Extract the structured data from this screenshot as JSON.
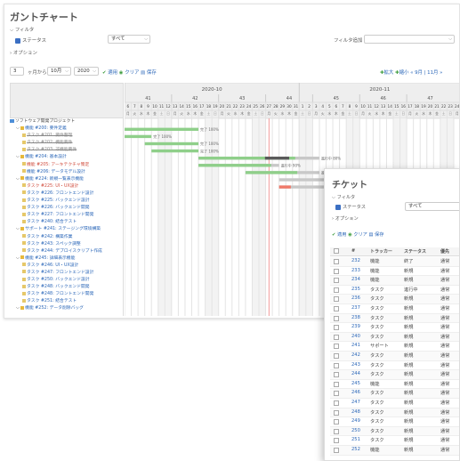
{
  "gantt": {
    "title": "ガントチャート",
    "filter_label": "フィルタ",
    "status_label": "ステータス",
    "status_value": "すべて",
    "filter_add_label": "フィルタ追加",
    "options_label": "オプション",
    "months_value": "3",
    "months_suffix": "ヶ月から",
    "month_value": "10月",
    "year_value": "2020",
    "apply": "適用",
    "clear": "クリア",
    "save": "保存",
    "zoom_in": "拡大",
    "zoom_out": "縮小",
    "nav": "« 9月 | 11月 »",
    "month_headers": [
      "2020-10",
      "2020-11"
    ],
    "week_numbers": [
      "41",
      "42",
      "43",
      "44",
      "45",
      "46",
      "47"
    ],
    "days": [
      "6",
      "7",
      "8",
      "9",
      "10",
      "11",
      "12",
      "13",
      "14",
      "15",
      "16",
      "17",
      "18",
      "19",
      "20",
      "21",
      "22",
      "23",
      "24",
      "25",
      "26",
      "27",
      "28",
      "29",
      "30",
      "31",
      "1",
      "2",
      "3",
      "4",
      "5",
      "6",
      "7",
      "8",
      "9",
      "10",
      "11",
      "12",
      "13",
      "14",
      "15",
      "16",
      "17",
      "18",
      "19",
      "20",
      "21",
      "22",
      "23",
      "24"
    ],
    "weekdays": [
      "月",
      "火",
      "水",
      "木",
      "金",
      "土",
      "日"
    ],
    "tree": [
      {
        "label": "ソフトウェア開発プロジェクト",
        "indent": 0,
        "type": "proj"
      },
      {
        "label": "機能 #200: 要件定義",
        "indent": 1,
        "type": "fold"
      },
      {
        "label": "タスク #201: 要件整理",
        "indent": 2,
        "type": "done"
      },
      {
        "label": "タスク #202: 機能要件",
        "indent": 2,
        "type": "done"
      },
      {
        "label": "タスク #203: 非機能要件",
        "indent": 2,
        "type": "done"
      },
      {
        "label": "機能 #204: 基本設計",
        "indent": 1,
        "type": "fold"
      },
      {
        "label": "機能 #205: アーキテクチャ策定",
        "indent": 2,
        "type": "red"
      },
      {
        "label": "機能 #206: データモデル設計",
        "indent": 2,
        "type": "task"
      },
      {
        "label": "機能 #224: 新規一覧表示機能",
        "indent": 1,
        "type": "fold"
      },
      {
        "label": "タスク #225: UI・UX設計",
        "indent": 2,
        "type": "red"
      },
      {
        "label": "タスク #226: フロントエンド設計",
        "indent": 2,
        "type": "task"
      },
      {
        "label": "タスク #225: バックエンド設計",
        "indent": 2,
        "type": "task"
      },
      {
        "label": "タスク #226: バックエンド開発",
        "indent": 2,
        "type": "task"
      },
      {
        "label": "タスク #227: フロントエンド開発",
        "indent": 2,
        "type": "task"
      },
      {
        "label": "タスク #240: 結合テスト",
        "indent": 2,
        "type": "task"
      },
      {
        "label": "サポート #241: ステージング環境構築",
        "indent": 1,
        "type": "fold"
      },
      {
        "label": "タスク #242: 構築作業",
        "indent": 2,
        "type": "task"
      },
      {
        "label": "タスク #243: スペック調整",
        "indent": 2,
        "type": "task"
      },
      {
        "label": "タスク #244: デプロイスクリプト作成",
        "indent": 2,
        "type": "task"
      },
      {
        "label": "機能 #245: 詳細表示機能",
        "indent": 1,
        "type": "fold"
      },
      {
        "label": "タスク #246: UI・UX設計",
        "indent": 2,
        "type": "task"
      },
      {
        "label": "タスク #247: フロントエンド設計",
        "indent": 2,
        "type": "task"
      },
      {
        "label": "タスク #250: バックエンド設計",
        "indent": 2,
        "type": "task"
      },
      {
        "label": "タスク #248: バックエンド開発",
        "indent": 2,
        "type": "task"
      },
      {
        "label": "タスク #248: フロントエンド開発",
        "indent": 2,
        "type": "task"
      },
      {
        "label": "タスク #251: 結合テスト",
        "indent": 2,
        "type": "task"
      },
      {
        "label": "機能 #252: データ削除バッグ",
        "indent": 1,
        "type": "fold"
      }
    ],
    "bars": [
      {
        "row": 1,
        "start": 0,
        "end": 11,
        "done": 1.0,
        "label": "完了 100%"
      },
      {
        "row": 2,
        "start": 0,
        "end": 4,
        "done": 1.0,
        "label": "完了 100%"
      },
      {
        "row": 3,
        "start": 3,
        "end": 11,
        "done": 1.0,
        "label": "完了 100%"
      },
      {
        "row": 4,
        "start": 4,
        "end": 11,
        "done": 1.0,
        "label": "完了 100%"
      },
      {
        "row": 5,
        "start": 11,
        "end": 29,
        "done": 0.8,
        "label": "進行中 80%"
      },
      {
        "row": 6,
        "start": 11,
        "end": 23,
        "done": 0.9,
        "label": "進行中 90%"
      },
      {
        "row": 7,
        "start": 18,
        "end": 29,
        "done": 0.7,
        "label": "進行中 70%"
      },
      {
        "row": 8,
        "start": 23,
        "end": 33,
        "done": 0.0,
        "label": "新規 0%"
      },
      {
        "row": 9,
        "start": 23,
        "end": 30,
        "done": 0.25,
        "label": "進行中 0%"
      },
      {
        "row": 10,
        "start": 30,
        "end": 33,
        "done": 0.0,
        "label": "新規 0%"
      }
    ]
  },
  "ticket": {
    "title": "チケット",
    "filter_label": "フィルタ",
    "status_label": "ステータス",
    "status_value": "すべて",
    "options_label": "オプション",
    "apply": "適用",
    "clear": "クリア",
    "save": "保存",
    "columns": [
      "#",
      "トラッカー",
      "ステータス",
      "優先"
    ],
    "rows": [
      [
        "232",
        "機能",
        "終了",
        "通常"
      ],
      [
        "233",
        "機能",
        "新規",
        "通常"
      ],
      [
        "234",
        "機能",
        "新規",
        "通常"
      ],
      [
        "235",
        "タスク",
        "進行中",
        "通常"
      ],
      [
        "236",
        "タスク",
        "新規",
        "通常"
      ],
      [
        "237",
        "タスク",
        "新規",
        "通常"
      ],
      [
        "238",
        "タスク",
        "新規",
        "通常"
      ],
      [
        "239",
        "タスク",
        "新規",
        "通常"
      ],
      [
        "240",
        "タスク",
        "新規",
        "通常"
      ],
      [
        "241",
        "サポート",
        "新規",
        "通常"
      ],
      [
        "242",
        "タスク",
        "新規",
        "通常"
      ],
      [
        "243",
        "タスク",
        "新規",
        "通常"
      ],
      [
        "244",
        "タスク",
        "新規",
        "通常"
      ],
      [
        "245",
        "機能",
        "新規",
        "通常"
      ],
      [
        "246",
        "タスク",
        "新規",
        "通常"
      ],
      [
        "247",
        "タスク",
        "新規",
        "通常"
      ],
      [
        "248",
        "タスク",
        "新規",
        "通常"
      ],
      [
        "249",
        "タスク",
        "新規",
        "通常"
      ],
      [
        "250",
        "タスク",
        "新規",
        "通常"
      ],
      [
        "251",
        "タスク",
        "新規",
        "通常"
      ],
      [
        "252",
        "機能",
        "新規",
        "通常"
      ]
    ]
  },
  "colors": {
    "done_bar": "#8fcf8a",
    "todo_bar": "#c8c8c8",
    "late": "#f07a6a",
    "progress": "#5a5a5a",
    "today": "#f29a9a",
    "link": "#2a66b8"
  }
}
